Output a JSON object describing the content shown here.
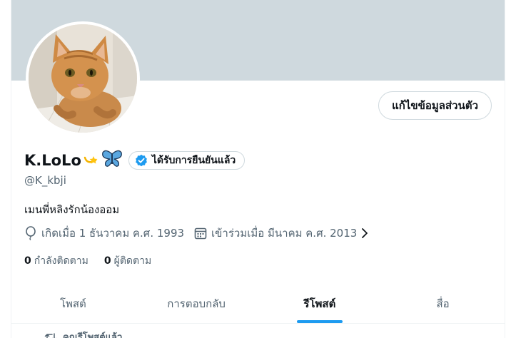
{
  "profile": {
    "display_name": "K.LoLo",
    "handle": "@K_kbji",
    "bio": "เมนพี่หลิงรักน้องออม",
    "verified_label": "ได้รับการยืนยันแล้ว",
    "avatar_description": "orange tabby cat",
    "name_emojis": [
      "dizzy-star-icon",
      "butterfly-icon"
    ]
  },
  "actions": {
    "edit_profile_label": "แก้ไขข้อมูลส่วนตัว"
  },
  "meta": {
    "birthday": "เกิดเมื่อ 1 ธันวาคม ค.ศ. 1993",
    "joined": "เข้าร่วมเมื่อ มีนาคม ค.ศ. 2013"
  },
  "stats": {
    "following_count": "0",
    "following_label": "กำลังติดตาม",
    "followers_count": "0",
    "followers_label": "ผู้ติดตาม"
  },
  "tabs": [
    {
      "label": "โพสต์",
      "active": false
    },
    {
      "label": "การตอบกลับ",
      "active": false
    },
    {
      "label": "รีโพสต์",
      "active": true
    },
    {
      "label": "สื่อ",
      "active": false
    }
  ],
  "feed": {
    "repost_notice": "คุณรีโพสต์แล้ว"
  },
  "colors": {
    "accent": "#1d9bf0",
    "banner": "#cfd9de",
    "muted_text": "#536471"
  }
}
